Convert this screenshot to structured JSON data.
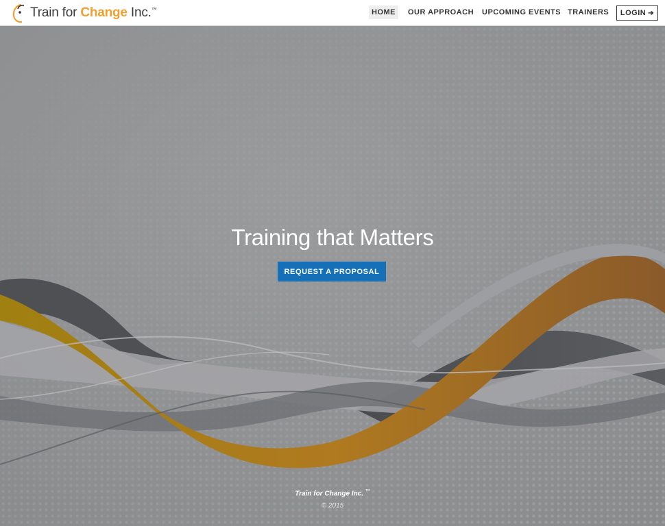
{
  "brand": {
    "name_prefix": "Train for ",
    "name_accent": "Change",
    "name_suffix": " Inc.",
    "trademark": "™",
    "accent_color": "#f0a030"
  },
  "nav": {
    "items": [
      {
        "label": "HOME",
        "active": true
      },
      {
        "label": "OUR APPROACH",
        "active": false
      },
      {
        "label": "UPCOMING EVENTS",
        "active": false
      },
      {
        "label": "TRAINERS",
        "active": false
      }
    ],
    "login_label": "LOGIN",
    "login_icon": "sign-in-icon"
  },
  "hero": {
    "title": "Training that Matters",
    "cta_label": "REQUEST A PROPOSAL",
    "cta_color": "#1570b8"
  },
  "footer": {
    "brand": "Train for Change Inc.",
    "trademark": "™",
    "copyright": "© 2015"
  }
}
